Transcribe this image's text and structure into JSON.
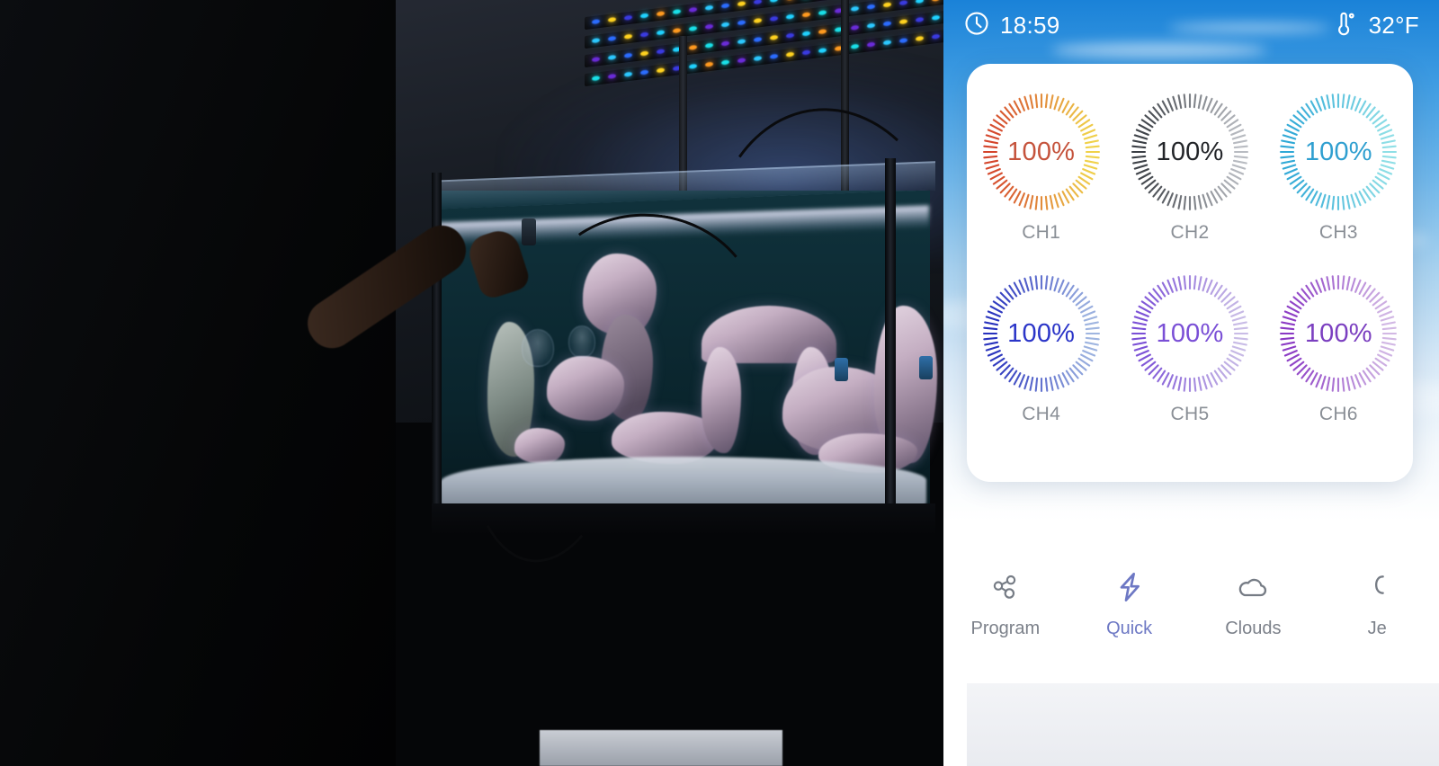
{
  "app": {
    "status_bar": {
      "clock_icon": "clock-icon",
      "time": "18:59",
      "thermometer_icon": "thermometer-icon",
      "temperature": "32°F"
    },
    "channels": [
      {
        "id": "ch1",
        "label": "CH1",
        "value": "100%",
        "percent": 100,
        "text_color": "#c5533c",
        "tick_from": "#d4452c",
        "tick_to": "#f0d24a"
      },
      {
        "id": "ch2",
        "label": "CH2",
        "value": "100%",
        "percent": 100,
        "text_color": "#222428",
        "tick_from": "#3b3f45",
        "tick_to": "#b9bcc2"
      },
      {
        "id": "ch3",
        "label": "CH3",
        "value": "100%",
        "percent": 100,
        "text_color": "#2f9fd0",
        "tick_from": "#2fa8d6",
        "tick_to": "#8fdfe6"
      },
      {
        "id": "ch4",
        "label": "CH4",
        "value": "100%",
        "percent": 100,
        "text_color": "#2b35c8",
        "tick_from": "#2731bd",
        "tick_to": "#9fb5e0"
      },
      {
        "id": "ch5",
        "label": "CH5",
        "value": "100%",
        "percent": 100,
        "text_color": "#7a4fd6",
        "tick_from": "#7a4fd6",
        "tick_to": "#c9bce6"
      },
      {
        "id": "ch6",
        "label": "CH6",
        "value": "100%",
        "percent": 100,
        "text_color": "#7b3fc0",
        "tick_from": "#8a39c4",
        "tick_to": "#d2b8e4"
      }
    ],
    "tabs": [
      {
        "id": "program",
        "label": "Program",
        "icon": "share-nodes-icon",
        "active": false
      },
      {
        "id": "quick",
        "label": "Quick",
        "icon": "lightning-bolt-icon",
        "active": true
      },
      {
        "id": "clouds",
        "label": "Clouds",
        "icon": "cloud-icon",
        "active": false
      },
      {
        "id": "jet",
        "label": "Je",
        "icon": "wave-icon",
        "active": false
      }
    ]
  },
  "photo": {
    "description": "Dark room with reef aquarium lit by LED fixture; a person's arm reaches into the tank"
  }
}
